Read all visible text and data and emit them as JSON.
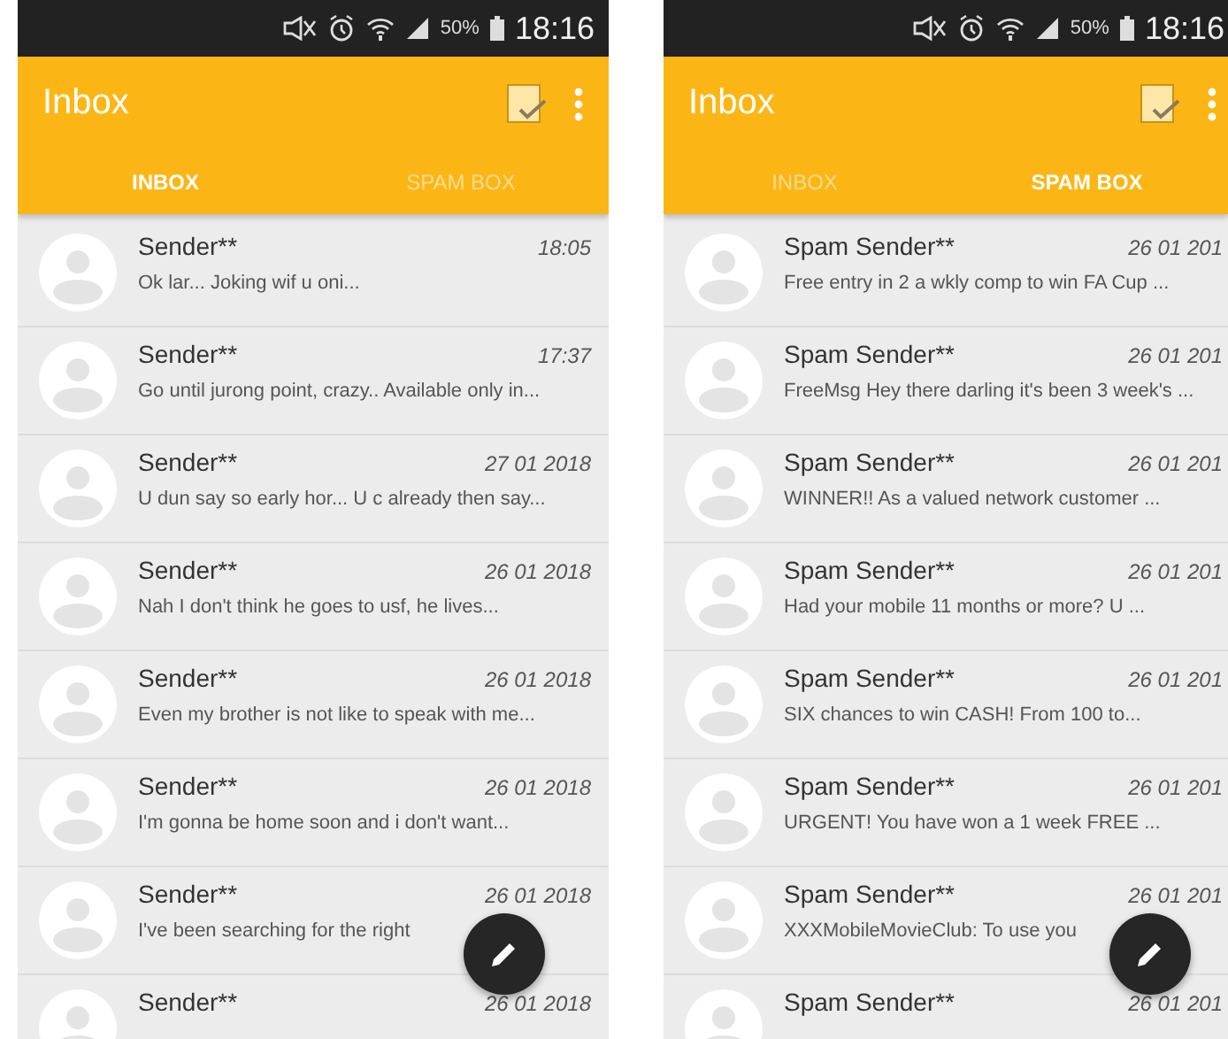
{
  "phones": [
    {
      "status_bar": {
        "battery": "50%",
        "time": "18:16"
      },
      "app_bar": {
        "title": "Inbox"
      },
      "tabs": [
        {
          "label": "INBOX",
          "selected": true
        },
        {
          "label": "SPAM BOX",
          "selected": false
        }
      ],
      "messages": [
        {
          "sender": "Sender**",
          "time": "18:05",
          "preview": "Ok lar... Joking wif u oni..."
        },
        {
          "sender": "Sender**",
          "time": "17:37",
          "preview": "Go until jurong point, crazy.. Available only in..."
        },
        {
          "sender": "Sender**",
          "time": "27 01 2018",
          "preview": "U dun say so early hor... U c already then say..."
        },
        {
          "sender": "Sender**",
          "time": "26 01 2018",
          "preview": "Nah I don't think he goes to usf, he lives..."
        },
        {
          "sender": "Sender**",
          "time": "26 01 2018",
          "preview": "Even my brother is not like to speak with me..."
        },
        {
          "sender": "Sender**",
          "time": "26 01 2018",
          "preview": "I'm gonna be home soon and i don't want..."
        },
        {
          "sender": "Sender**",
          "time": "26 01 2018",
          "preview": "I've been searching for the right"
        },
        {
          "sender": "Sender**",
          "time": "26 01 2018"
        }
      ]
    },
    {
      "status_bar": {
        "battery": "50%",
        "time": "18:16"
      },
      "app_bar": {
        "title": "Inbox"
      },
      "tabs": [
        {
          "label": "INBOX",
          "selected": false
        },
        {
          "label": "SPAM BOX",
          "selected": true
        }
      ],
      "messages": [
        {
          "sender": "Spam Sender**",
          "time": "26 01 201",
          "preview": "Free entry in 2 a wkly comp to win FA Cup ..."
        },
        {
          "sender": "Spam Sender**",
          "time": "26 01 201",
          "preview": "FreeMsg Hey there darling it's been 3 week's ..."
        },
        {
          "sender": "Spam Sender**",
          "time": "26 01 201",
          "preview": "WINNER!! As a valued network customer ..."
        },
        {
          "sender": "Spam Sender**",
          "time": "26 01 201",
          "preview": "Had your mobile 11 months or more? U ..."
        },
        {
          "sender": "Spam Sender**",
          "time": "26 01 201",
          "preview": "SIX chances to win CASH! From 100 to..."
        },
        {
          "sender": "Spam Sender**",
          "time": "26 01 201",
          "preview": "URGENT! You have won a 1 week FREE ..."
        },
        {
          "sender": "Spam Sender**",
          "time": "26 01 201",
          "preview": "XXXMobileMovieClub: To use you"
        },
        {
          "sender": "Spam Sender**",
          "time": "26 01 201"
        }
      ]
    }
  ]
}
